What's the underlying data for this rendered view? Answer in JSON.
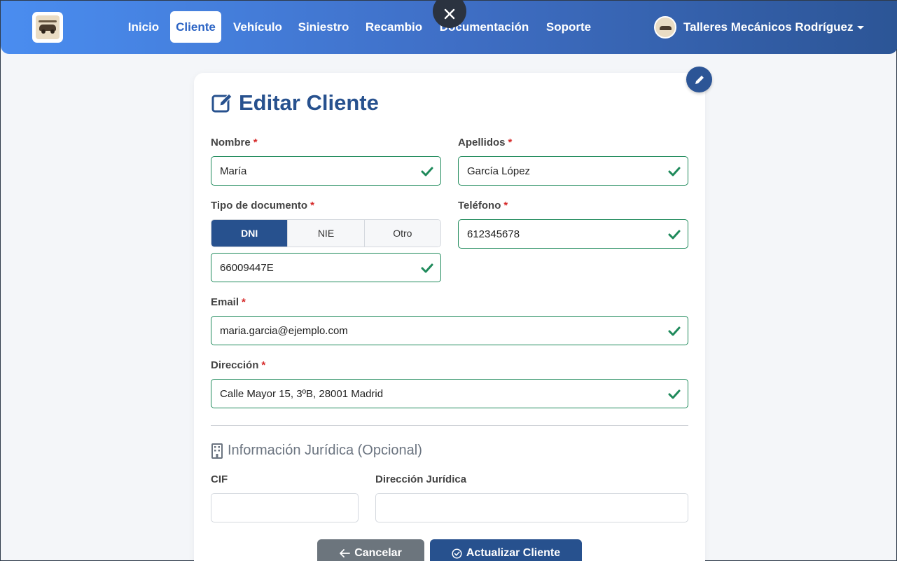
{
  "nav": {
    "items": [
      {
        "label": "Inicio",
        "active": false
      },
      {
        "label": "Cliente",
        "active": true
      },
      {
        "label": "Vehículo",
        "active": false
      },
      {
        "label": "Siniestro",
        "active": false
      },
      {
        "label": "Recambio",
        "active": false
      },
      {
        "label": "Documentación",
        "active": false
      },
      {
        "label": "Soporte",
        "active": false
      }
    ],
    "user_name": "Talleres Mecánicos Rodríguez"
  },
  "form": {
    "title": "Editar Cliente",
    "required_mark": "*",
    "nombre": {
      "label": "Nombre",
      "value": "María"
    },
    "apellidos": {
      "label": "Apellidos",
      "value": "García López"
    },
    "tipo_documento": {
      "label": "Tipo de documento",
      "options": [
        "DNI",
        "NIE",
        "Otro"
      ],
      "selected": "DNI",
      "value": "66009447E"
    },
    "telefono": {
      "label": "Teléfono",
      "value": "612345678"
    },
    "email": {
      "label": "Email",
      "value": "maria.garcia@ejemplo.com"
    },
    "direccion": {
      "label": "Dirección",
      "value": "Calle Mayor 15, 3ºB, 28001 Madrid"
    },
    "juridica": {
      "section_title": "Información Jurídica (Opcional)",
      "cif": {
        "label": "CIF",
        "value": ""
      },
      "direccion_juridica": {
        "label": "Dirección Jurídica",
        "value": ""
      }
    },
    "buttons": {
      "cancel": "Cancelar",
      "save": "Actualizar Cliente"
    }
  },
  "colors": {
    "primary": "#27518e",
    "valid": "#1f8a5b",
    "required": "#d62b2b",
    "secondary": "#6c757d"
  }
}
